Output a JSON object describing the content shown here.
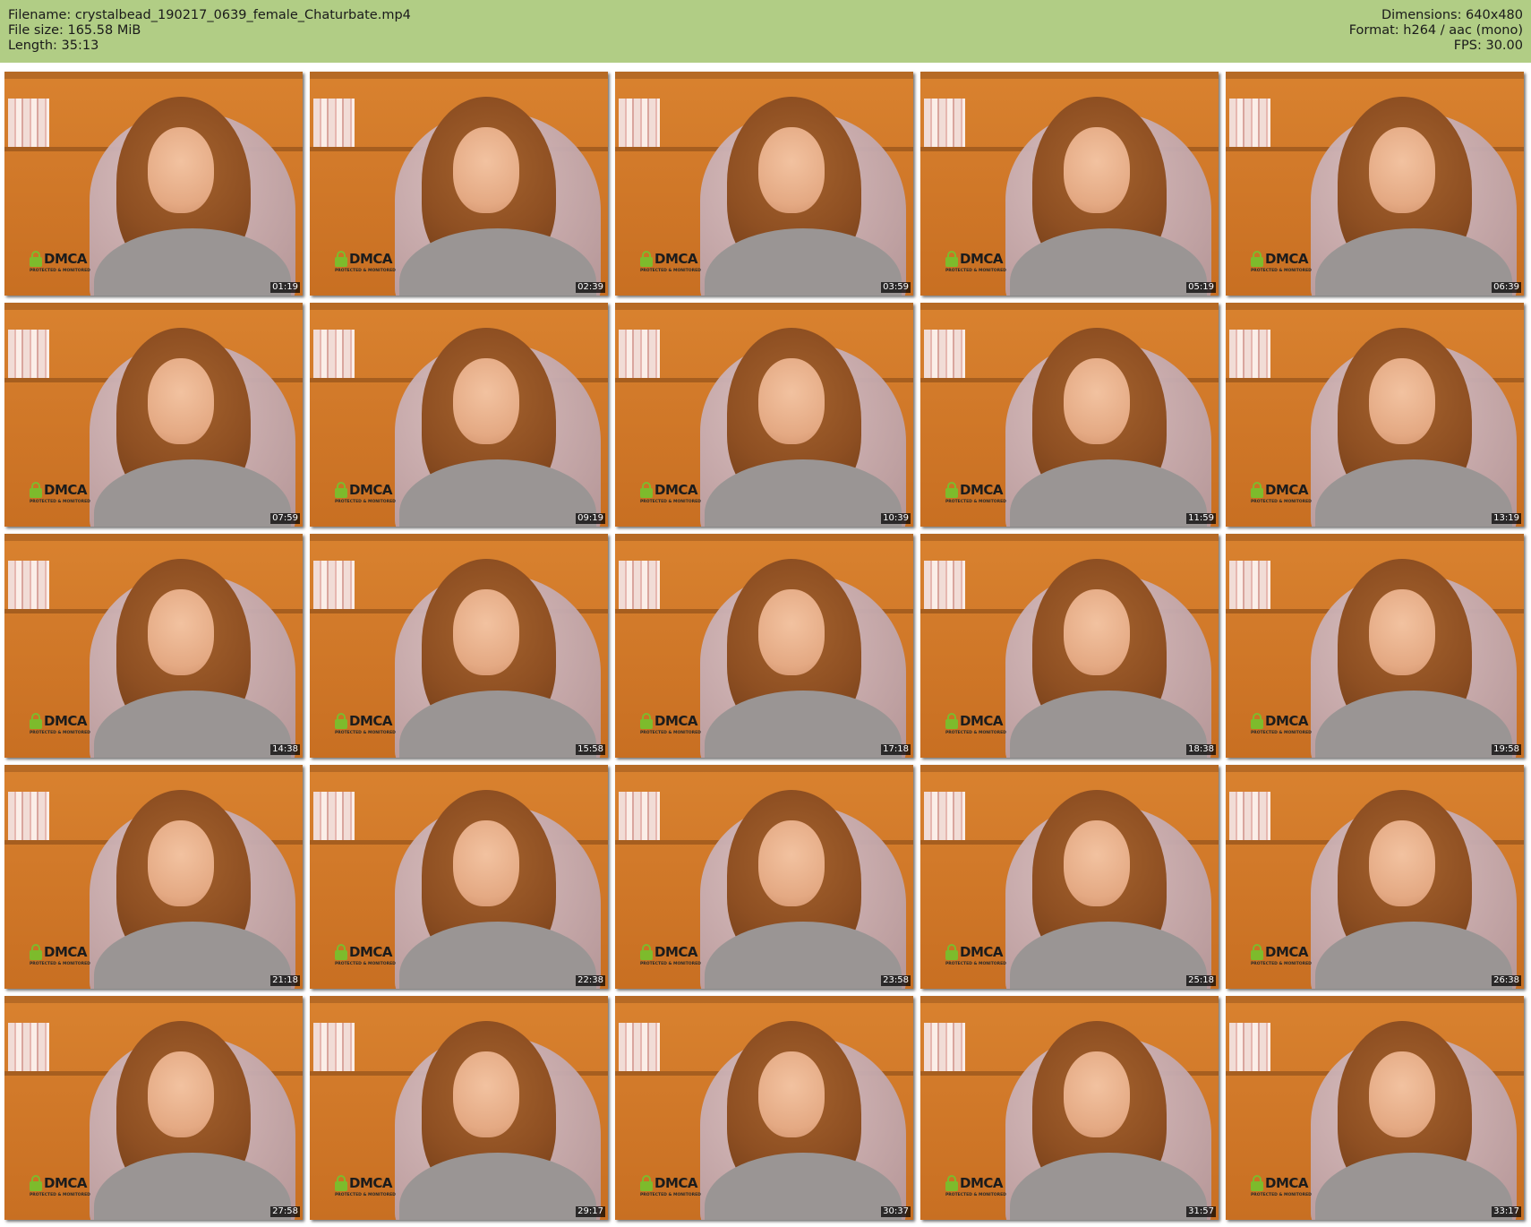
{
  "header": {
    "filename": "Filename: crystalbead_190217_0639_female_Chaturbate.mp4",
    "file_size": "File size: 165.58 MiB",
    "length": "Length: 35:13",
    "dimensions": "Dimensions: 640x480",
    "format": "Format: h264 / aac (mono)",
    "fps": "FPS: 30.00",
    "background_color": "#b1cd85"
  },
  "watermark": {
    "logo_text": "DMCA",
    "subtitle": "PROTECTED & MONITORED"
  },
  "thumbnails": [
    {
      "timestamp": "01:19"
    },
    {
      "timestamp": "02:39"
    },
    {
      "timestamp": "03:59"
    },
    {
      "timestamp": "05:19"
    },
    {
      "timestamp": "06:39"
    },
    {
      "timestamp": "07:59"
    },
    {
      "timestamp": "09:19"
    },
    {
      "timestamp": "10:39"
    },
    {
      "timestamp": "11:59"
    },
    {
      "timestamp": "13:19"
    },
    {
      "timestamp": "14:38"
    },
    {
      "timestamp": "15:58"
    },
    {
      "timestamp": "17:18"
    },
    {
      "timestamp": "18:38"
    },
    {
      "timestamp": "19:58"
    },
    {
      "timestamp": "21:18"
    },
    {
      "timestamp": "22:38"
    },
    {
      "timestamp": "23:58"
    },
    {
      "timestamp": "25:18"
    },
    {
      "timestamp": "26:38"
    },
    {
      "timestamp": "27:58"
    },
    {
      "timestamp": "29:17"
    },
    {
      "timestamp": "30:37"
    },
    {
      "timestamp": "31:57"
    },
    {
      "timestamp": "33:17"
    }
  ]
}
